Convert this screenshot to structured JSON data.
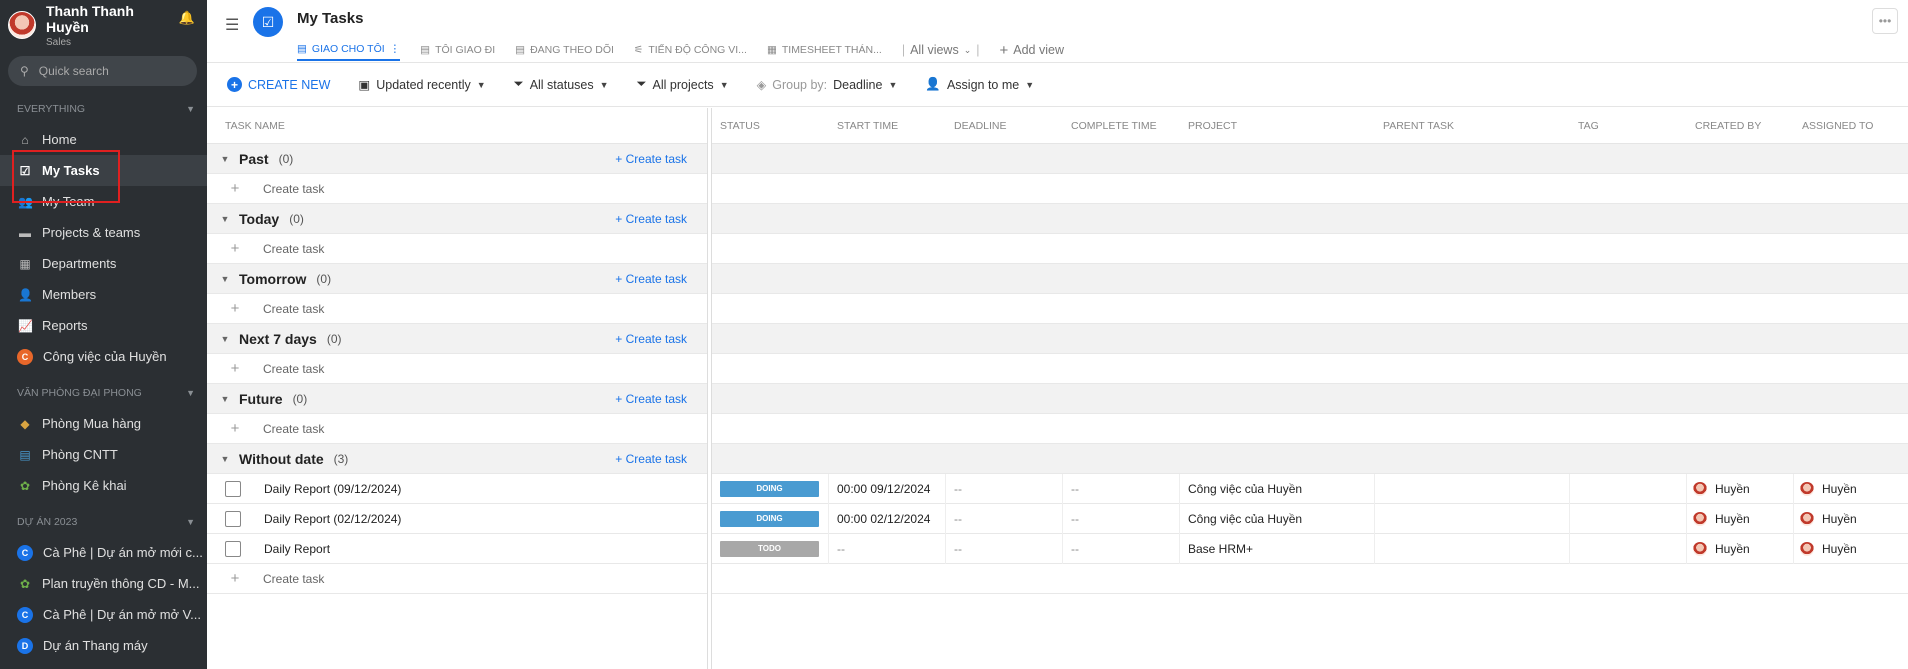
{
  "user": {
    "name": "Thanh Thanh Huyền",
    "role": "Sales"
  },
  "search": {
    "placeholder": "Quick search"
  },
  "sidebar": {
    "section1": "EVERYTHING",
    "items": [
      {
        "label": "Home"
      },
      {
        "label": "My Tasks"
      },
      {
        "label": "My Team"
      },
      {
        "label": "Projects & teams"
      },
      {
        "label": "Departments"
      },
      {
        "label": "Members"
      },
      {
        "label": "Reports"
      },
      {
        "label": "Công việc của Huyền",
        "letter": "C"
      }
    ],
    "section2": "VĂN PHÒNG ĐẠI PHONG",
    "items2": [
      {
        "label": "Phòng Mua hàng"
      },
      {
        "label": "Phòng CNTT"
      },
      {
        "label": "Phòng Kê khai"
      }
    ],
    "section3": "DỰ ÁN 2023",
    "items3": [
      {
        "label": "Cà Phê | Dự án mở mới c...",
        "letter": "C"
      },
      {
        "label": "Plan truyền thông CD - M..."
      },
      {
        "label": "Cà Phê | Dự án mở mở V...",
        "letter": "C"
      },
      {
        "label": "Dự án Thang máy",
        "letter": "D"
      }
    ]
  },
  "header": {
    "title": "My Tasks",
    "tabs": [
      "GIAO CHO TÔI",
      "TÔI GIAO ĐI",
      "ĐANG THEO DÕI",
      "TIẾN ĐỘ CÔNG VI...",
      "TIMESHEET THÁN..."
    ],
    "all_views": "All views",
    "add_view": "Add view"
  },
  "toolbar": {
    "create": "CREATE NEW",
    "sort": "Updated recently",
    "status": "All statuses",
    "projects": "All projects",
    "group_by_label": "Group by:",
    "group_by_value": "Deadline",
    "assign": "Assign to me"
  },
  "columns": {
    "task_name": "TASK NAME",
    "right": [
      "STATUS",
      "START TIME",
      "DEADLINE",
      "COMPLETE TIME",
      "PROJECT",
      "PARENT TASK",
      "TAG",
      "CREATED BY",
      "ASSIGNED TO"
    ]
  },
  "create_task": "Create task",
  "create_task_link": "+ Create task",
  "groups": [
    {
      "name": "Past",
      "count": "(0)"
    },
    {
      "name": "Today",
      "count": "(0)"
    },
    {
      "name": "Tomorrow",
      "count": "(0)"
    },
    {
      "name": "Next 7 days",
      "count": "(0)"
    },
    {
      "name": "Future",
      "count": "(0)"
    },
    {
      "name": "Without date",
      "count": "(3)"
    }
  ],
  "tasks": [
    {
      "name": "Daily Report (09/12/2024)",
      "status": "DOING",
      "status_color": "#4a9bd1",
      "start": "00:00 09/12/2024",
      "deadline": "--",
      "complete": "--",
      "project": "Công việc của Huyền",
      "created_by": "Huyền",
      "assigned_to": "Huyền"
    },
    {
      "name": "Daily Report (02/12/2024)",
      "status": "DOING",
      "status_color": "#4a9bd1",
      "start": "00:00 02/12/2024",
      "deadline": "--",
      "complete": "--",
      "project": "Công việc của Huyền",
      "created_by": "Huyền",
      "assigned_to": "Huyền"
    },
    {
      "name": "Daily Report",
      "status": "TODO",
      "status_color": "#a8a8a8",
      "start": "--",
      "deadline": "--",
      "complete": "--",
      "project": "Base HRM+",
      "created_by": "Huyền",
      "assigned_to": "Huyền"
    }
  ],
  "colors": {
    "accent": "#1a73e8",
    "sidebar_bg": "#2b2f33",
    "doing": "#4a9bd1",
    "todo": "#a8a8a8",
    "highlight": "#e02020"
  }
}
